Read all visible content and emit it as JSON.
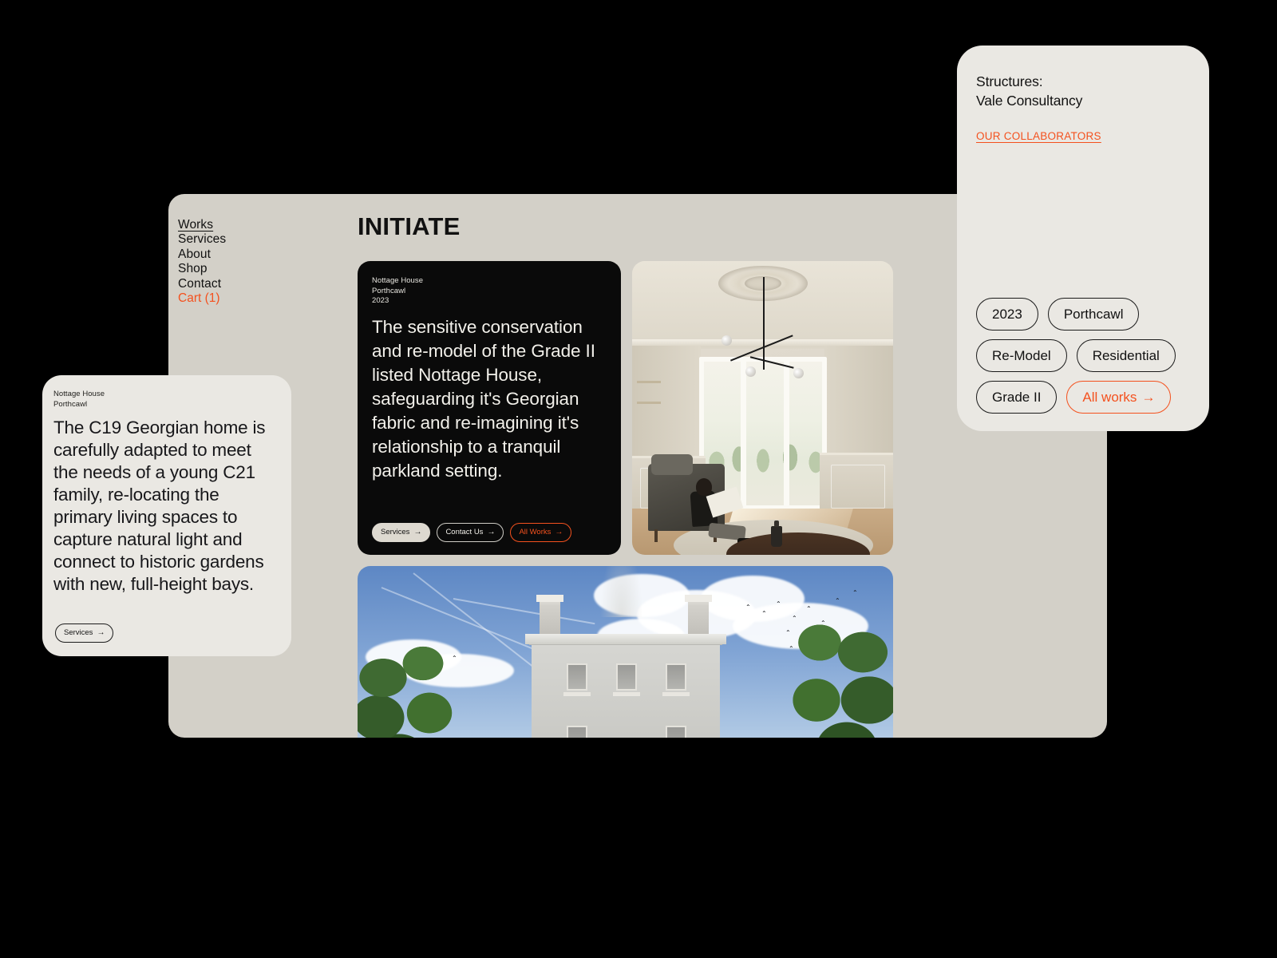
{
  "site": {
    "nav": [
      {
        "label": "Works",
        "active": true
      },
      {
        "label": "Services",
        "active": false
      },
      {
        "label": "About",
        "active": false
      },
      {
        "label": "Shop",
        "active": false
      },
      {
        "label": "Contact",
        "active": false
      }
    ],
    "cart_label": "Cart (1)",
    "page_title": "INITIATE"
  },
  "project_card": {
    "name": "Nottage House",
    "location": "Porthcawl",
    "year": "2023",
    "description": "The sensitive conservation and re-model of the Grade II listed Nottage House, safeguarding it's Georgian fabric and re-imagining it's relationship to a tranquil parkland setting.",
    "actions": [
      {
        "label": "Services",
        "arrow": "→",
        "style": "solid"
      },
      {
        "label": "Contact Us",
        "arrow": "→",
        "style": "outline-light"
      },
      {
        "label": "All Works",
        "arrow": "→",
        "style": "outline-orange"
      }
    ]
  },
  "detail_card": {
    "name": "Nottage House",
    "location": "Porthcawl",
    "body": "The C19 Georgian home is carefully adapted to meet the needs of a young C21 family, re-locating the primary living spaces to capture natural light and connect to historic gardens with new, full-height bays.",
    "action": {
      "label": "Services",
      "arrow": "→"
    }
  },
  "info_panel": {
    "heading_line_1": "Structures:",
    "heading_line_2": "Vale Consultancy",
    "collaborators_link": "OUR COLLABORATORS",
    "tags": [
      {
        "label": "2023",
        "accent": false
      },
      {
        "label": "Porthcawl",
        "accent": false
      },
      {
        "label": "Re-Model",
        "accent": false
      },
      {
        "label": "Residential",
        "accent": false
      },
      {
        "label": "Grade II",
        "accent": false
      },
      {
        "label": "All works",
        "accent": true,
        "arrow": "→"
      }
    ]
  },
  "media": {
    "interior": "interior-render-bay-window-reading",
    "exterior": "exterior-render-georgian-house"
  },
  "colors": {
    "background": "#000000",
    "panel": "#d3d0c8",
    "card": "#eae8e3",
    "dark_card": "#0a0a0a",
    "accent": "#f4511e",
    "text": "#111111"
  }
}
